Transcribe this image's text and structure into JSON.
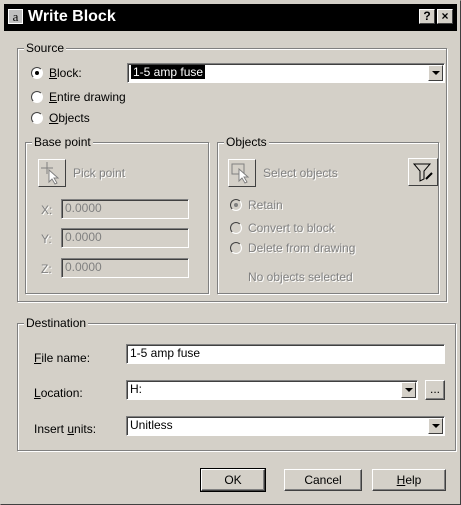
{
  "window": {
    "title": "Write Block",
    "help_glyph": "?",
    "close_glyph": "×"
  },
  "source": {
    "group_label": "Source",
    "block_label": "Block:",
    "entire_drawing_label": "Entire drawing",
    "objects_label": "Objects",
    "block_value": "1-5 amp fuse",
    "selected_option": "Block"
  },
  "base_point": {
    "group_label": "Base point",
    "pick_point_label": "Pick point",
    "x_label": "X:",
    "x_value": "0.0000",
    "y_label": "Y:",
    "y_value": "0.0000",
    "z_label": "Z:",
    "z_value": "0.0000"
  },
  "objects": {
    "group_label": "Objects",
    "select_objects_label": "Select objects",
    "retain_label": "Retain",
    "convert_label": "Convert to block",
    "delete_label": "Delete from drawing",
    "status_text": "No objects selected"
  },
  "destination": {
    "group_label": "Destination",
    "file_name_label": "File name:",
    "file_name_value": "1-5 amp fuse",
    "location_label": "Location:",
    "location_value": "H:",
    "browse_label": "...",
    "insert_units_label": "Insert units:",
    "insert_units_value": "Unitless"
  },
  "buttons": {
    "ok": "OK",
    "cancel": "Cancel",
    "help": "Help"
  },
  "colors": {
    "face": "#d4d0c8",
    "titlebar": "#000000",
    "disabled_text": "#808080"
  }
}
